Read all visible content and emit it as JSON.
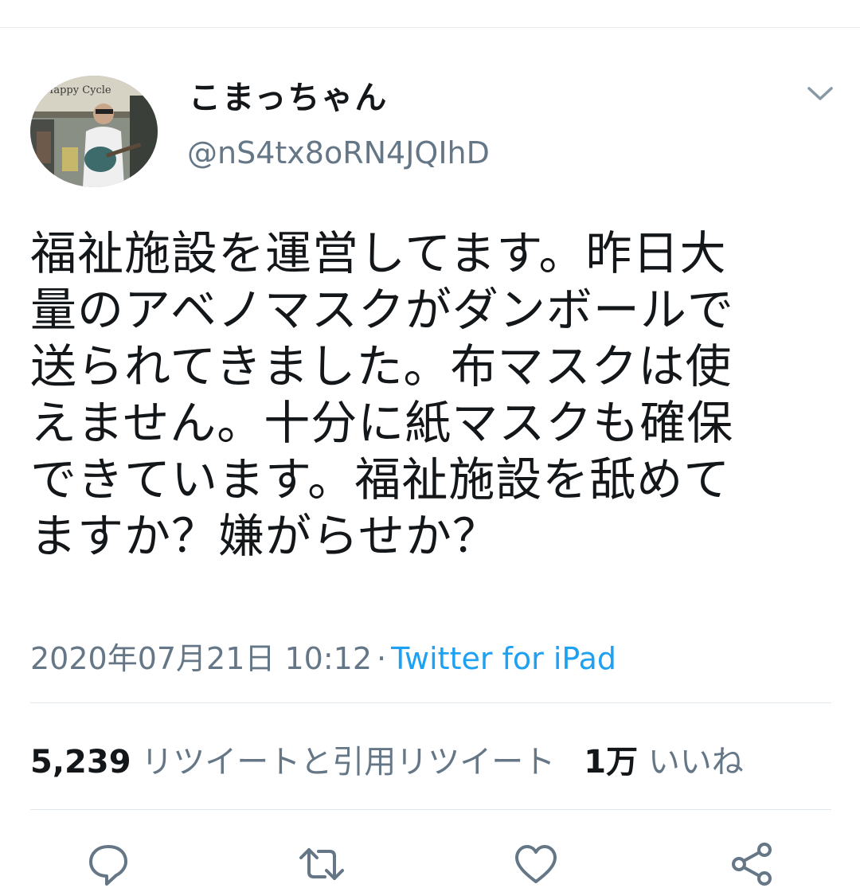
{
  "tweet": {
    "author": {
      "display_name": "こまっちゃん",
      "handle": "@nS4tx8oRN4JQIhD",
      "avatar_sign_text": "Happy Cycle"
    },
    "text": "福祉施設を運営してます。昨日大\n量のアベノマスクがダンボールで\n送られてきました。布マスクは使\nえません。十分に紙マスクも確保\nできています。福祉施設を舐めて\nますか？嫌がらせか？",
    "timestamp": "2020年07月21日 10:12",
    "separator": "·",
    "source": "Twitter for iPad",
    "retweets": {
      "count": "5,239",
      "label": "リツイートと引用リツイート"
    },
    "likes": {
      "count": "1万",
      "label": "いいね"
    }
  },
  "actions": [
    "reply-icon",
    "retweet-icon",
    "like-icon",
    "share-icon"
  ],
  "colors": {
    "accent": "#1da1f2",
    "text": "#14171a",
    "secondary": "#657786",
    "divider": "#e1e8ed"
  }
}
